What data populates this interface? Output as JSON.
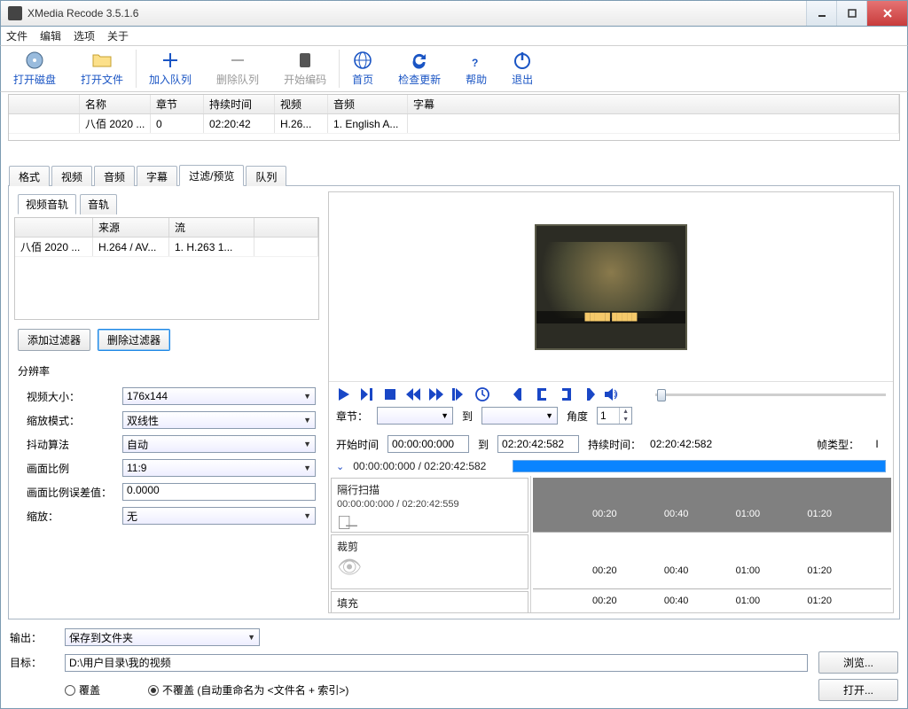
{
  "window": {
    "title": "XMedia Recode 3.5.1.6"
  },
  "menu": {
    "file": "文件",
    "edit": "编辑",
    "options": "选项",
    "about": "关于"
  },
  "toolbar": {
    "open_disc": "打开磁盘",
    "open_file": "打开文件",
    "add_queue": "加入队列",
    "remove_queue": "删除队列",
    "start_encode": "开始编码",
    "home": "首页",
    "check_update": "检查更新",
    "help": "帮助",
    "exit": "退出"
  },
  "filelist": {
    "cols": {
      "name": "名称",
      "chapter": "章节",
      "duration": "持续时间",
      "video": "视频",
      "audio": "音频",
      "subtitle": "字幕"
    },
    "row": {
      "name": "八佰 2020 ...",
      "chapter": "0",
      "duration": "02:20:42",
      "video": "H.26...",
      "audio": "1. English A...",
      "subtitle": ""
    }
  },
  "tabs": {
    "format": "格式",
    "video": "视频",
    "audio": "音频",
    "subtitle": "字幕",
    "filter": "过滤/预览",
    "queue": "队列"
  },
  "subtabs": {
    "video_track": "视频音轨",
    "audio_track": "音轨"
  },
  "srcgrid": {
    "cols": {
      "source": "来源",
      "stream": "流"
    },
    "row": {
      "name": "八佰 2020 ...",
      "source": "H.264 / AV...",
      "stream": "1. H.263 1..."
    }
  },
  "filterbtns": {
    "add": "添加过滤器",
    "del": "删除过滤器"
  },
  "res": {
    "group": "分辨率",
    "size_label": "视频大小：",
    "size_value": "176x144",
    "scale_label": "缩放模式：",
    "scale_value": "双线性",
    "dither_label": "抖动算法",
    "dither_value": "自动",
    "ar_label": "画面比例",
    "ar_value": "11:9",
    "ar_err_label": "画面比例误差值：",
    "ar_err_value": "0.0000",
    "zoom_label": "缩放：",
    "zoom_value": "无"
  },
  "player": {
    "chapter_label": "章节：",
    "to": "到",
    "angle_label": "角度",
    "angle_value": "1",
    "start_label": "开始时间",
    "start_value": "00:00:00:000",
    "end_value": "02:20:42:582",
    "dur_label": "持续时间：",
    "dur_value": "02:20:42:582",
    "frametype_label": "帧类型：",
    "frametype_value": "I",
    "seek_times": "00:00:00:000 / 02:20:42:582"
  },
  "tracks": {
    "interlace": "隔行扫描",
    "interlace_times": "00:00:00:000 / 02:20:42:559",
    "crop": "裁剪",
    "fill": "填充",
    "marks": [
      "00:20",
      "00:40",
      "01:00",
      "01:20"
    ]
  },
  "output": {
    "out_label": "输出：",
    "out_value": "保存到文件夹",
    "target_label": "目标：",
    "target_value": "D:\\用户目录\\我的视频",
    "overwrite": "覆盖",
    "no_overwrite": "不覆盖 (自动重命名为 <文件名 + 索引>)",
    "browse": "浏览...",
    "open": "打开..."
  }
}
